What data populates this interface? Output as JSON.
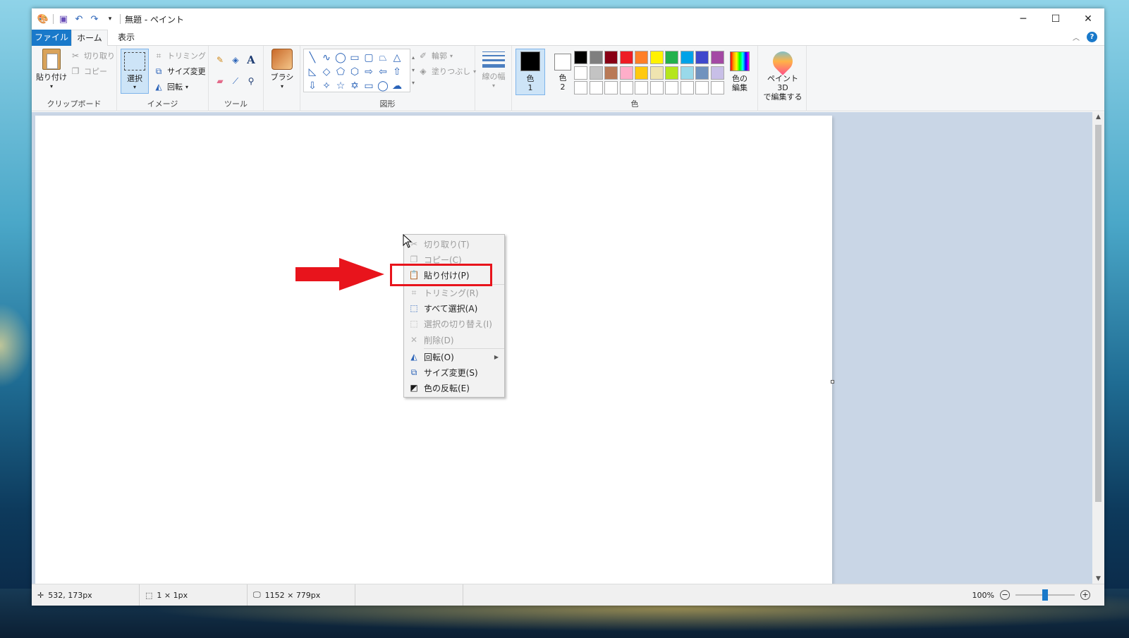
{
  "window": {
    "title": "無題 - ペイント",
    "controls": {
      "minimize": "─",
      "maximize": "☐",
      "close": "✕"
    }
  },
  "tabs": [
    {
      "label": "ファイル"
    },
    {
      "label": "ホーム"
    },
    {
      "label": "表示"
    }
  ],
  "ribbon": {
    "clipboard": {
      "paste": "貼り付け",
      "cut": "切り取り",
      "copy": "コピー",
      "label": "クリップボード"
    },
    "image": {
      "select": "選択",
      "crop": "トリミング",
      "resize": "サイズ変更",
      "rotate": "回転",
      "label": "イメージ"
    },
    "tools": {
      "label": "ツール"
    },
    "brush": {
      "label": "ブラシ"
    },
    "shapes": {
      "outline": "輪郭",
      "fill": "塗りつぶし",
      "label": "図形"
    },
    "size": {
      "label": "線の幅"
    },
    "colors": {
      "color1_a": "色",
      "color1_b": "1",
      "color2_a": "色",
      "color2_b": "2",
      "edit_a": "色の",
      "edit_b": "編集",
      "label": "色",
      "color1_value": "#000000",
      "color2_value": "#ffffff",
      "palette": [
        "#000000",
        "#7f7f7f",
        "#880015",
        "#ed1c24",
        "#ff7f27",
        "#fff200",
        "#22b14c",
        "#00a2e8",
        "#3f48cc",
        "#a349a4",
        "#ffffff",
        "#c3c3c3",
        "#b97a57",
        "#ffaec9",
        "#ffc90e",
        "#efe4b0",
        "#b5e61d",
        "#99d9ea",
        "#7092be",
        "#c8bfe7",
        "#ffffff",
        "#ffffff",
        "#ffffff",
        "#ffffff",
        "#ffffff",
        "#ffffff",
        "#ffffff",
        "#ffffff",
        "#ffffff",
        "#ffffff"
      ]
    },
    "paint3d": {
      "line1": "ペイント 3D",
      "line2": "で編集する"
    }
  },
  "context_menu": {
    "items": [
      {
        "label": "切り取り(T)",
        "icon": "scissors-icon",
        "enabled": false
      },
      {
        "label": "コピー(C)",
        "icon": "copy-icon",
        "enabled": false
      },
      {
        "label": "貼り付け(P)",
        "icon": "paste-icon",
        "enabled": true
      },
      {
        "label": "トリミング(R)",
        "icon": "crop-icon",
        "enabled": false
      },
      {
        "label": "すべて選択(A)",
        "icon": "select-all-icon",
        "enabled": true
      },
      {
        "label": "選択の切り替え(I)",
        "icon": "invert-selection-icon",
        "enabled": false
      },
      {
        "label": "削除(D)",
        "icon": "delete-icon",
        "enabled": false
      },
      {
        "label": "回転(O)",
        "icon": "rotate-icon",
        "enabled": true
      },
      {
        "label": "サイズ変更(S)",
        "icon": "resize-icon",
        "enabled": true
      },
      {
        "label": "色の反転(E)",
        "icon": "invert-color-icon",
        "enabled": true
      }
    ]
  },
  "annotation": {
    "highlight_color": "#e8141c"
  },
  "status": {
    "cursor": "532, 173px",
    "selection": "1 × 1px",
    "image_size": "1152 × 779px",
    "zoom": "100%"
  }
}
